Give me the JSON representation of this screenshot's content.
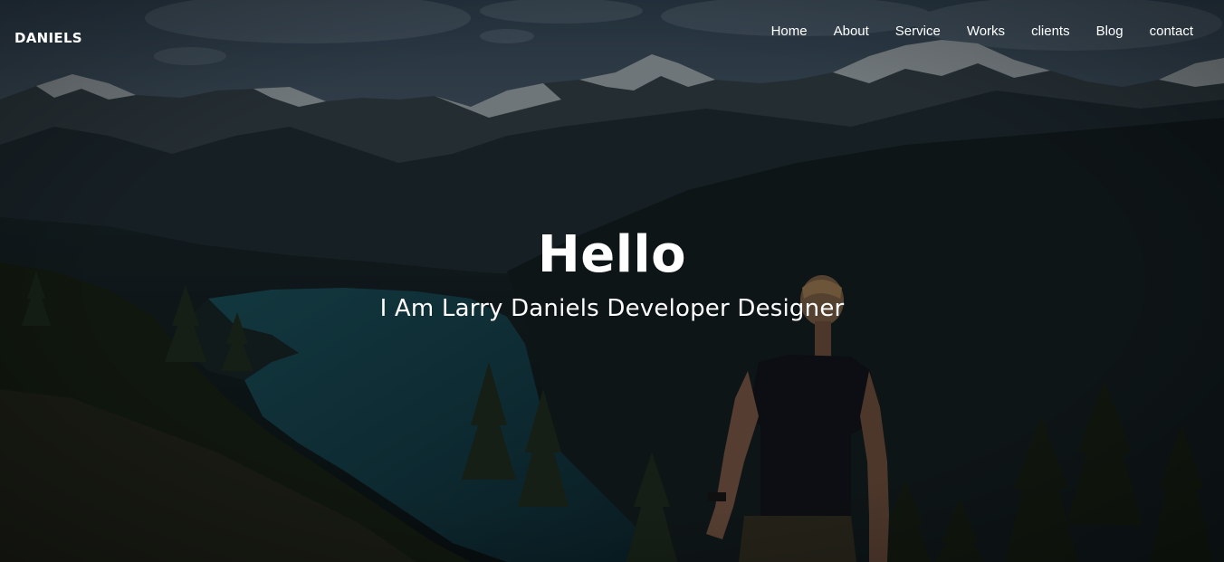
{
  "header": {
    "brand": "DANIELS"
  },
  "nav": {
    "items": [
      {
        "label": "Home"
      },
      {
        "label": "About"
      },
      {
        "label": "Service"
      },
      {
        "label": "Works"
      },
      {
        "label": "clients"
      },
      {
        "label": "Blog"
      },
      {
        "label": "contact"
      }
    ]
  },
  "hero": {
    "title": "Hello",
    "subtitle": "I Am Larry Daniels Developer Designer",
    "background_image": "mountain-lake-hiker-photo"
  }
}
